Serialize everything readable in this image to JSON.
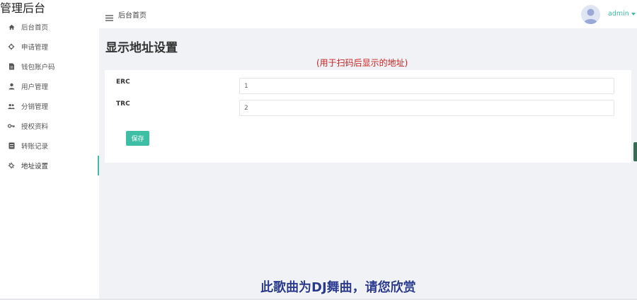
{
  "brand": {
    "title": "管理后台"
  },
  "sidebar": {
    "items": [
      {
        "label": "后台首页",
        "icon": "home-icon"
      },
      {
        "label": "申请管理",
        "icon": "gear-icon"
      },
      {
        "label": "钱包账户码",
        "icon": "document-icon"
      },
      {
        "label": "用户管理",
        "icon": "user-icon"
      },
      {
        "label": "分销管理",
        "icon": "users-icon"
      },
      {
        "label": "授权资料",
        "icon": "key-icon"
      },
      {
        "label": "转账记录",
        "icon": "list-icon"
      },
      {
        "label": "地址设置",
        "icon": "settings-icon",
        "active": true
      }
    ]
  },
  "header": {
    "title": "后台首页",
    "username": "admin"
  },
  "main": {
    "page_title": "显示地址设置",
    "subtitle": "(用于扫码后显示的地址)",
    "fields": [
      {
        "label": "ERC",
        "value": "1"
      },
      {
        "label": "TRC",
        "value": "2"
      }
    ],
    "save_label": "保存"
  },
  "caption": "此歌曲为DJ舞曲，请您欣赏",
  "colors": {
    "accent": "#3ebfa5",
    "warning_text": "#cc1f1f",
    "caption": "#2a3a8f"
  }
}
